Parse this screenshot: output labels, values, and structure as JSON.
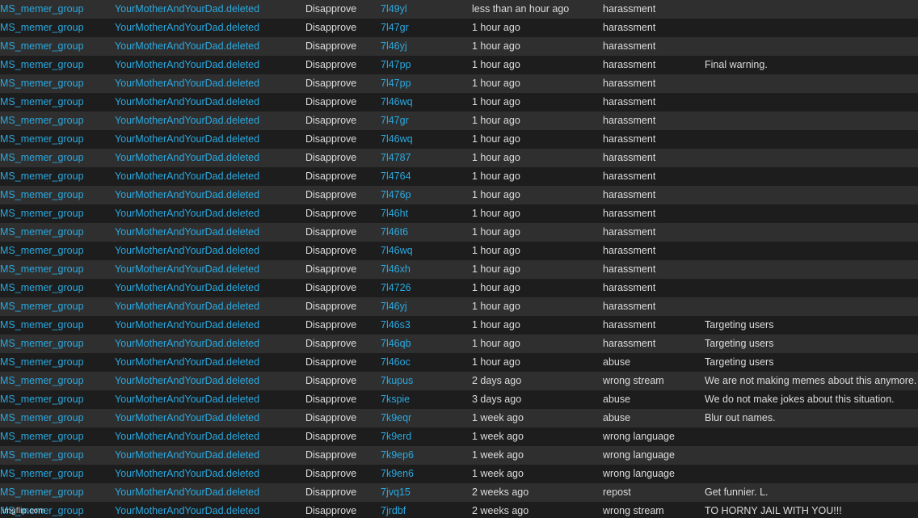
{
  "watermark": "imgflip.com",
  "log": {
    "rows": [
      {
        "stream": "MS_memer_group",
        "user": "YourMotherAndYourDad.deleted",
        "action": "Disapprove",
        "image": "7l49yl",
        "time": "less than an hour ago",
        "reason": "harassment",
        "note": ""
      },
      {
        "stream": "MS_memer_group",
        "user": "YourMotherAndYourDad.deleted",
        "action": "Disapprove",
        "image": "7l47gr",
        "time": "1 hour ago",
        "reason": "harassment",
        "note": ""
      },
      {
        "stream": "MS_memer_group",
        "user": "YourMotherAndYourDad.deleted",
        "action": "Disapprove",
        "image": "7l46yj",
        "time": "1 hour ago",
        "reason": "harassment",
        "note": ""
      },
      {
        "stream": "MS_memer_group",
        "user": "YourMotherAndYourDad.deleted",
        "action": "Disapprove",
        "image": "7l47pp",
        "time": "1 hour ago",
        "reason": "harassment",
        "note": "Final warning."
      },
      {
        "stream": "MS_memer_group",
        "user": "YourMotherAndYourDad.deleted",
        "action": "Disapprove",
        "image": "7l47pp",
        "time": "1 hour ago",
        "reason": "harassment",
        "note": ""
      },
      {
        "stream": "MS_memer_group",
        "user": "YourMotherAndYourDad.deleted",
        "action": "Disapprove",
        "image": "7l46wq",
        "time": "1 hour ago",
        "reason": "harassment",
        "note": ""
      },
      {
        "stream": "MS_memer_group",
        "user": "YourMotherAndYourDad.deleted",
        "action": "Disapprove",
        "image": "7l47gr",
        "time": "1 hour ago",
        "reason": "harassment",
        "note": ""
      },
      {
        "stream": "MS_memer_group",
        "user": "YourMotherAndYourDad.deleted",
        "action": "Disapprove",
        "image": "7l46wq",
        "time": "1 hour ago",
        "reason": "harassment",
        "note": ""
      },
      {
        "stream": "MS_memer_group",
        "user": "YourMotherAndYourDad.deleted",
        "action": "Disapprove",
        "image": "7l4787",
        "time": "1 hour ago",
        "reason": "harassment",
        "note": ""
      },
      {
        "stream": "MS_memer_group",
        "user": "YourMotherAndYourDad.deleted",
        "action": "Disapprove",
        "image": "7l4764",
        "time": "1 hour ago",
        "reason": "harassment",
        "note": ""
      },
      {
        "stream": "MS_memer_group",
        "user": "YourMotherAndYourDad.deleted",
        "action": "Disapprove",
        "image": "7l476p",
        "time": "1 hour ago",
        "reason": "harassment",
        "note": ""
      },
      {
        "stream": "MS_memer_group",
        "user": "YourMotherAndYourDad.deleted",
        "action": "Disapprove",
        "image": "7l46ht",
        "time": "1 hour ago",
        "reason": "harassment",
        "note": ""
      },
      {
        "stream": "MS_memer_group",
        "user": "YourMotherAndYourDad.deleted",
        "action": "Disapprove",
        "image": "7l46t6",
        "time": "1 hour ago",
        "reason": "harassment",
        "note": ""
      },
      {
        "stream": "MS_memer_group",
        "user": "YourMotherAndYourDad.deleted",
        "action": "Disapprove",
        "image": "7l46wq",
        "time": "1 hour ago",
        "reason": "harassment",
        "note": ""
      },
      {
        "stream": "MS_memer_group",
        "user": "YourMotherAndYourDad.deleted",
        "action": "Disapprove",
        "image": "7l46xh",
        "time": "1 hour ago",
        "reason": "harassment",
        "note": ""
      },
      {
        "stream": "MS_memer_group",
        "user": "YourMotherAndYourDad.deleted",
        "action": "Disapprove",
        "image": "7l4726",
        "time": "1 hour ago",
        "reason": "harassment",
        "note": ""
      },
      {
        "stream": "MS_memer_group",
        "user": "YourMotherAndYourDad.deleted",
        "action": "Disapprove",
        "image": "7l46yj",
        "time": "1 hour ago",
        "reason": "harassment",
        "note": ""
      },
      {
        "stream": "MS_memer_group",
        "user": "YourMotherAndYourDad.deleted",
        "action": "Disapprove",
        "image": "7l46s3",
        "time": "1 hour ago",
        "reason": "harassment",
        "note": "Targeting users"
      },
      {
        "stream": "MS_memer_group",
        "user": "YourMotherAndYourDad.deleted",
        "action": "Disapprove",
        "image": "7l46qb",
        "time": "1 hour ago",
        "reason": "harassment",
        "note": "Targeting users"
      },
      {
        "stream": "MS_memer_group",
        "user": "YourMotherAndYourDad.deleted",
        "action": "Disapprove",
        "image": "7l46oc",
        "time": "1 hour ago",
        "reason": "abuse",
        "note": "Targeting users"
      },
      {
        "stream": "MS_memer_group",
        "user": "YourMotherAndYourDad.deleted",
        "action": "Disapprove",
        "image": "7kupus",
        "time": "2 days ago",
        "reason": "wrong stream",
        "note": "We are not making memes about this anymore."
      },
      {
        "stream": "MS_memer_group",
        "user": "YourMotherAndYourDad.deleted",
        "action": "Disapprove",
        "image": "7kspie",
        "time": "3 days ago",
        "reason": "abuse",
        "note": "We do not make jokes about this situation."
      },
      {
        "stream": "MS_memer_group",
        "user": "YourMotherAndYourDad.deleted",
        "action": "Disapprove",
        "image": "7k9eqr",
        "time": "1 week ago",
        "reason": "abuse",
        "note": "Blur out names."
      },
      {
        "stream": "MS_memer_group",
        "user": "YourMotherAndYourDad.deleted",
        "action": "Disapprove",
        "image": "7k9erd",
        "time": "1 week ago",
        "reason": "wrong language",
        "note": ""
      },
      {
        "stream": "MS_memer_group",
        "user": "YourMotherAndYourDad.deleted",
        "action": "Disapprove",
        "image": "7k9ep6",
        "time": "1 week ago",
        "reason": "wrong language",
        "note": ""
      },
      {
        "stream": "MS_memer_group",
        "user": "YourMotherAndYourDad.deleted",
        "action": "Disapprove",
        "image": "7k9en6",
        "time": "1 week ago",
        "reason": "wrong language",
        "note": ""
      },
      {
        "stream": "MS_memer_group",
        "user": "YourMotherAndYourDad.deleted",
        "action": "Disapprove",
        "image": "7jvq15",
        "time": "2 weeks ago",
        "reason": "repost",
        "note": "Get funnier. L."
      },
      {
        "stream": "MS_memer_group",
        "user": "YourMotherAndYourDad.deleted",
        "action": "Disapprove",
        "image": "7jrdbf",
        "time": "2 weeks ago",
        "reason": "wrong stream",
        "note": "TO HORNY JAIL WITH YOU!!!"
      }
    ]
  }
}
